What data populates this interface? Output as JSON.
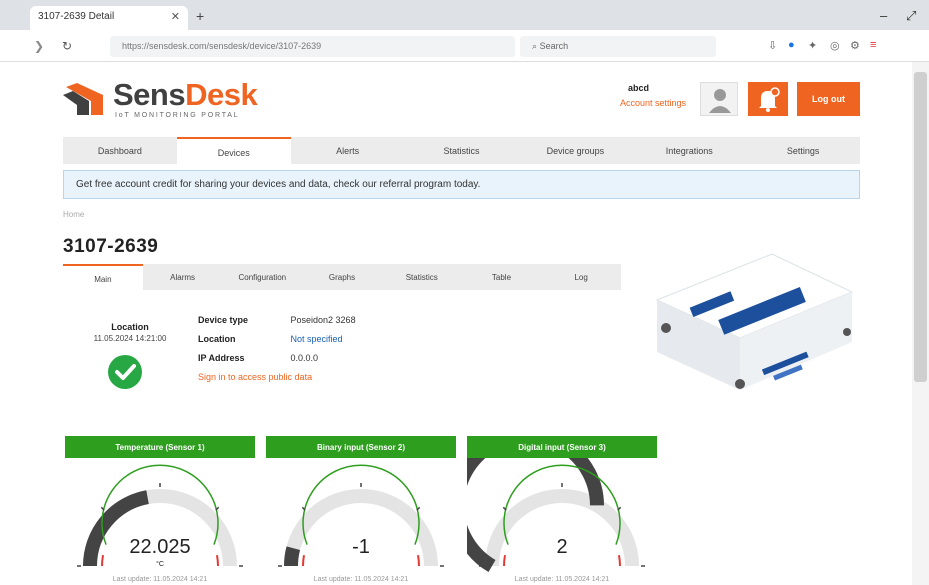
{
  "browser": {
    "tab_title": "3107-2639 Detail",
    "url": "https://sensdesk.com/sensdesk/device/3107-2639",
    "search_placeholder": "Search"
  },
  "header": {
    "logo_text_a": "Sens",
    "logo_text_b": "Desk",
    "tagline": "IoT MONITORING PORTAL",
    "user_name": "abcd",
    "user_link": "Account settings",
    "logout_label": "Log out"
  },
  "nav": {
    "items": [
      "Dashboard",
      "Devices",
      "Alerts",
      "Statistics",
      "Device groups",
      "Integrations",
      "Settings"
    ],
    "active_index": 1
  },
  "alert": {
    "text": "Get free account credit for sharing your devices and data, check our referral program today."
  },
  "breadcrumb": "Home",
  "device": {
    "title": "3107-2639"
  },
  "subtabs": {
    "items": [
      "Main",
      "Alarms",
      "Configuration",
      "Graphs",
      "Statistics",
      "Table",
      "Log"
    ],
    "active_index": 0
  },
  "location": {
    "label": "Location",
    "time": "11.05.2024 14:21:00"
  },
  "info": {
    "rows": [
      {
        "key": "Device type",
        "value": "Poseidon2 3268",
        "link": false
      },
      {
        "key": "Location",
        "value": "Not specified",
        "link": true
      },
      {
        "key": "IP Address",
        "value": "0.0.0.0",
        "link": false
      }
    ],
    "warning": "Sign in to access public data"
  },
  "colors": {
    "brand_orange": "#f06421",
    "gauge_green": "#2e9e1f",
    "link_blue": "#1a5fb4"
  },
  "gauges": [
    {
      "title": "Temperature (Sensor 1)",
      "value": "22.025",
      "unit": "°C",
      "min": -40,
      "max": 100,
      "current": 22.025,
      "footer": "Last update: 11.05.2024 14:21"
    },
    {
      "title": "Binary input (Sensor 2)",
      "value": "-1",
      "unit": "",
      "min": -10,
      "max": 100,
      "current": -1,
      "footer": "Last update: 11.05.2024 14:21"
    },
    {
      "title": "Digital input (Sensor 3)",
      "value": "2",
      "unit": "",
      "min": 0,
      "max": 3,
      "current": 2,
      "footer": "Last update: 11.05.2024 14:21"
    }
  ]
}
